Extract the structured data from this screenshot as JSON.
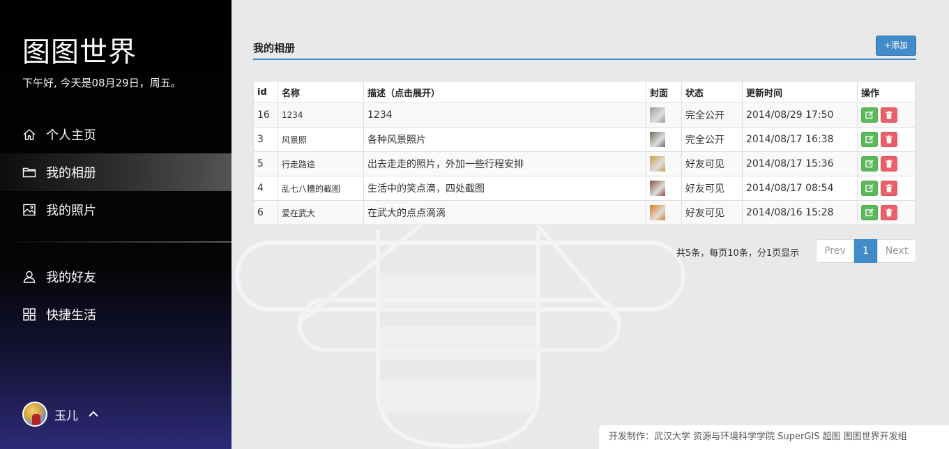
{
  "sidebar": {
    "logo": "图图世界",
    "greeting": "下午好, 今天是08月29日，周五。",
    "nav": [
      {
        "label": "个人主页",
        "icon": "home-icon"
      },
      {
        "label": "我的相册",
        "icon": "folder-icon"
      },
      {
        "label": "我的照片",
        "icon": "image-icon"
      },
      {
        "label": "我的好友",
        "icon": "user-icon"
      },
      {
        "label": "快捷生活",
        "icon": "grid-icon"
      }
    ],
    "user": {
      "name": "玉儿",
      "icon": "chevron-up-icon"
    }
  },
  "main": {
    "title": "我的相册",
    "add_label": "+添加",
    "table": {
      "headers": [
        "id",
        "名称",
        "描述（点击展开）",
        "封面",
        "状态",
        "更新时间",
        "操作"
      ],
      "rows": [
        {
          "id": "16",
          "name": "1234",
          "desc": "1234",
          "cover_color": "#9a9a9a",
          "status": "完全公开",
          "time": "2014/08/29 17:50"
        },
        {
          "id": "3",
          "name": "风景照",
          "desc": "各种风景照片",
          "cover_color": "#6b6f5a",
          "status": "完全公开",
          "time": "2014/08/17 16:38"
        },
        {
          "id": "5",
          "name": "行走路途",
          "desc": "出去走走的照片，外加一些行程安排",
          "cover_color": "#c9a13d",
          "status": "好友可见",
          "time": "2014/08/17 15:36"
        },
        {
          "id": "4",
          "name": "乱七八糟的截图",
          "desc": "生活中的笑点滴，四处截图",
          "cover_color": "#8a4f3e",
          "status": "好友可见",
          "time": "2014/08/17 08:54"
        },
        {
          "id": "6",
          "name": "爱在武大",
          "desc": "在武大的点点滴滴",
          "cover_color": "#d9791c",
          "status": "好友可见",
          "time": "2014/08/16 15:28"
        }
      ]
    },
    "pager": {
      "info": "共5条，每页10条，分1页显示",
      "prev": "Prev",
      "current": "1",
      "next": "Next"
    }
  },
  "footer": "开发制作：武汉大学 资源与环境科学学院 SuperGIS 超图 图图世界开发组",
  "colors": {
    "accent": "#428bca",
    "edit": "#5cb85c",
    "delete": "#e9606b"
  }
}
